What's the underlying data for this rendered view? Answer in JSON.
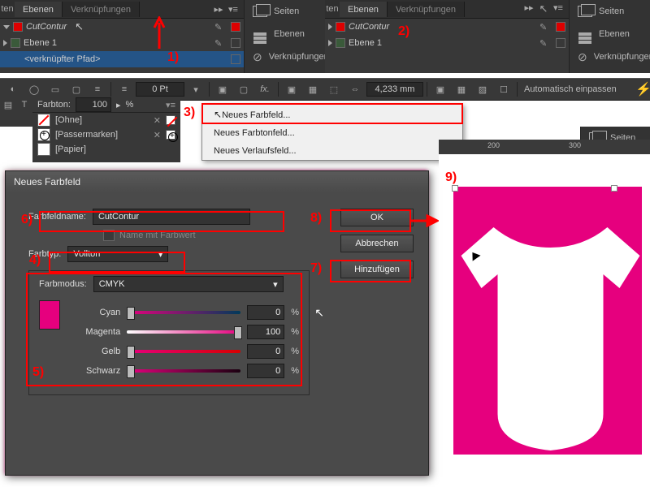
{
  "panels": {
    "tabs": {
      "ebenen": "Ebenen",
      "verknuepf": "Verknüpfungen"
    },
    "layers": {
      "cutcontur": "CutContur",
      "ebene1": "Ebene 1",
      "child": "<verknüpfter Pfad>"
    },
    "side": {
      "seiten": "Seiten",
      "ebenen": "Ebenen",
      "verknuepf": "Verknüpfungen"
    }
  },
  "toolbar": {
    "pt": "0 Pt",
    "mm": "4,233 mm",
    "auto": "Automatisch einpassen",
    "farbton": "Farbton:",
    "farbton_val": "100"
  },
  "swatches": {
    "ohne": "[Ohne]",
    "passer": "[Passermarken]",
    "papier": "[Papier]"
  },
  "menu": {
    "neues_farbfeld": "Neues Farbfeld...",
    "neues_farbtonfeld": "Neues Farbtonfeld...",
    "neues_verlaufsfeld": "Neues Verlaufsfeld..."
  },
  "dialog": {
    "title": "Neues Farbfeld",
    "name_label": "Farbfeldname:",
    "name_value": "CutContur",
    "name_mit_farbwert": "Name mit Farbwert",
    "farbtyp_label": "Farbtyp:",
    "farbtyp_value": "Vollton",
    "farbmodus_label": "Farbmodus:",
    "farbmodus_value": "CMYK",
    "cyan": "Cyan",
    "magenta": "Magenta",
    "gelb": "Gelb",
    "schwarz": "Schwarz",
    "c": "0",
    "m": "100",
    "y": "0",
    "k": "0",
    "pct": "%",
    "ok": "OK",
    "abbrechen": "Abbrechen",
    "hinzufuegen": "Hinzufügen"
  },
  "ann": {
    "n1": "1)",
    "n2": "2)",
    "n3": "3)",
    "n4": "4)",
    "n5": "5)",
    "n6": "6)",
    "n7": "7)",
    "n8": "8)",
    "n9": "9)"
  },
  "ruler": {
    "t200": "200",
    "t300": "300"
  },
  "seiten_side": "Seiten",
  "cursor_arrow_hint": "↑"
}
